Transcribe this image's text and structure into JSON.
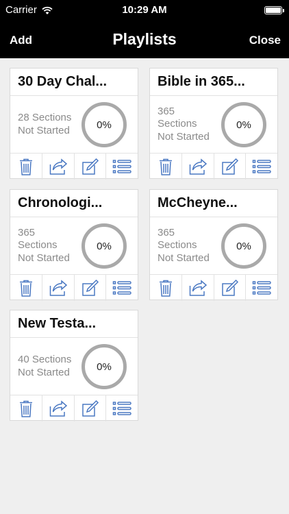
{
  "status_bar": {
    "carrier": "Carrier",
    "time": "10:29 AM"
  },
  "nav": {
    "add_label": "Add",
    "title": "Playlists",
    "close_label": "Close"
  },
  "playlists": [
    {
      "title": "30 Day Chal...",
      "line1": "28 Sections",
      "line2": "Not Started",
      "line3": "",
      "progress": "0%"
    },
    {
      "title": "Bible in 365...",
      "line1": "365",
      "line2": "Sections",
      "line3": "Not Started",
      "progress": "0%"
    },
    {
      "title": "Chronologi...",
      "line1": "365",
      "line2": "Sections",
      "line3": "Not Started",
      "progress": "0%"
    },
    {
      "title": "McCheyne...",
      "line1": "365",
      "line2": "Sections",
      "line3": "Not Started",
      "progress": "0%"
    },
    {
      "title": "New Testa...",
      "line1": "40 Sections",
      "line2": "Not Started",
      "line3": "",
      "progress": "0%"
    }
  ],
  "card_actions": [
    "trash-icon",
    "share-icon",
    "edit-icon",
    "list-icon"
  ],
  "colors": {
    "header_bg": "#000000",
    "background": "#efefef",
    "icon_blue": "#4a78c2",
    "ring_gray": "#a9a9a9",
    "subtitle_gray": "#8a8a8a"
  }
}
